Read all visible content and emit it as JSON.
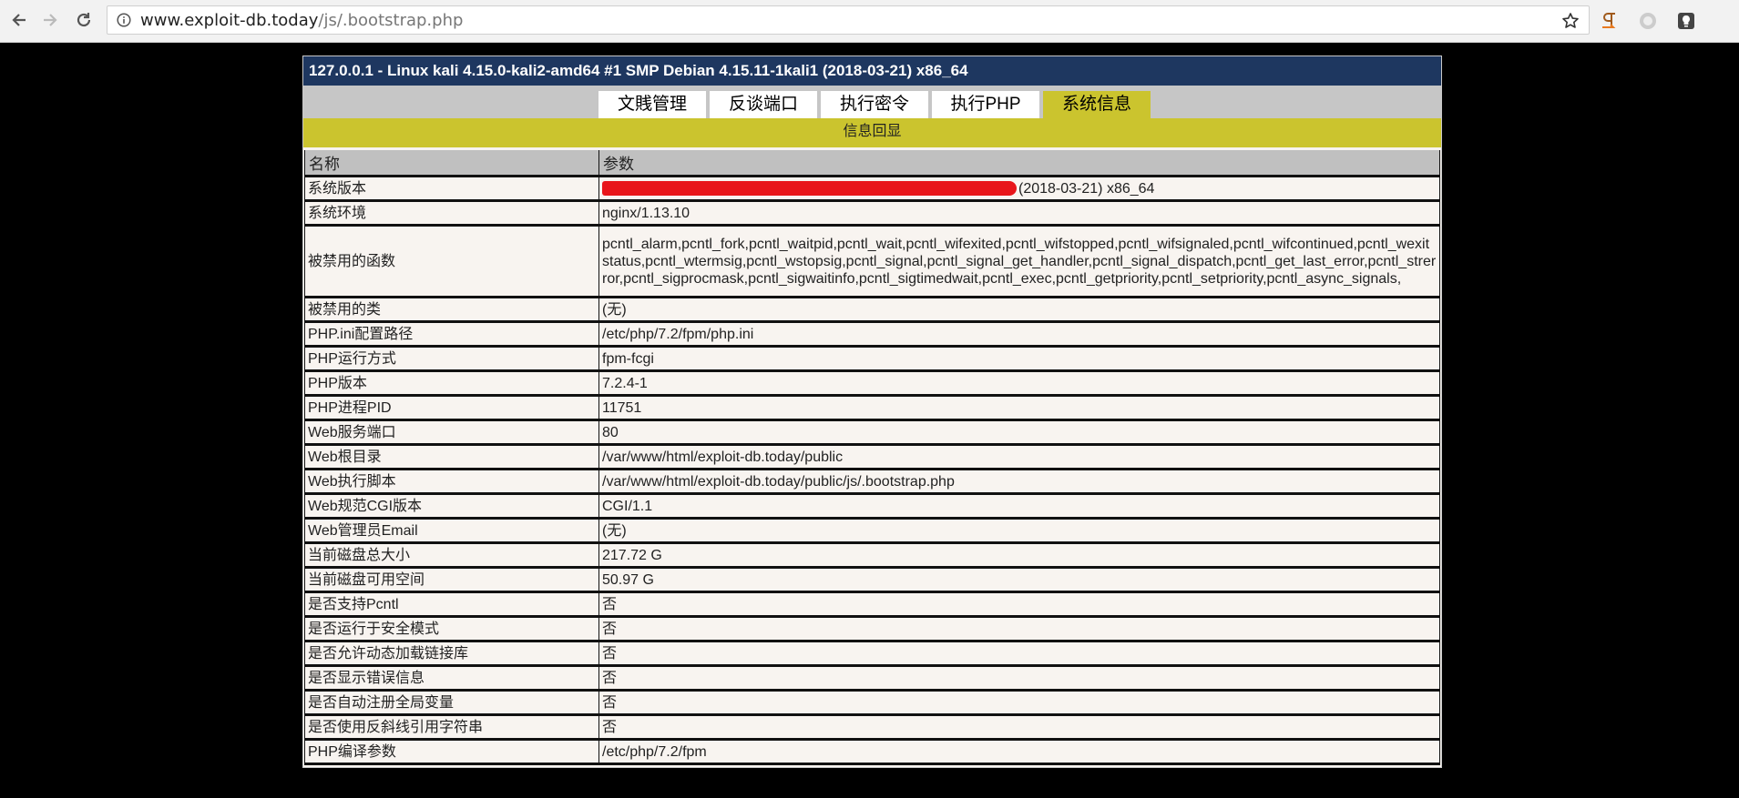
{
  "browser": {
    "url_host": "www.exploit-db.today",
    "url_path": "/js/.bootstrap.php"
  },
  "page": {
    "title": "127.0.0.1 - Linux kali 4.15.0-kali2-amd64 #1 SMP Debian 4.15.11-1kali1 (2018-03-21) x86_64",
    "tabs": [
      {
        "label": "文賎管理",
        "active": false
      },
      {
        "label": "反谈端口",
        "active": false
      },
      {
        "label": "执行密令",
        "active": false
      },
      {
        "label": "执行PHP",
        "active": false
      },
      {
        "label": "系统信息",
        "active": true
      }
    ],
    "section_title": "信息回显",
    "table": {
      "headers": [
        "名称",
        "参数"
      ],
      "rows": [
        {
          "name": "系统版本",
          "value": "(2018-03-21) x86_64"
        },
        {
          "name": "系统环境",
          "value": "nginx/1.13.10"
        },
        {
          "name": "被禁用的函数",
          "value": "pcntl_alarm,pcntl_fork,pcntl_waitpid,pcntl_wait,pcntl_wifexited,pcntl_wifstopped,pcntl_wifsignaled,pcntl_wifcontinued,pcntl_wexitstatus,pcntl_wtermsig,pcntl_wstopsig,pcntl_signal,pcntl_signal_get_handler,pcntl_signal_dispatch,pcntl_get_last_error,pcntl_strerror,pcntl_sigprocmask,pcntl_sigwaitinfo,pcntl_sigtimedwait,pcntl_exec,pcntl_getpriority,pcntl_setpriority,pcntl_async_signals,"
        },
        {
          "name": "被禁用的类",
          "value": "(无)"
        },
        {
          "name": "PHP.ini配置路径",
          "value": "/etc/php/7.2/fpm/php.ini"
        },
        {
          "name": "PHP运行方式",
          "value": "fpm-fcgi"
        },
        {
          "name": "PHP版本",
          "value": "7.2.4-1"
        },
        {
          "name": "PHP进程PID",
          "value": "11751"
        },
        {
          "name": "Web服务端口",
          "value": "80"
        },
        {
          "name": "Web根目录",
          "value": "/var/www/html/exploit-db.today/public"
        },
        {
          "name": "Web执行脚本",
          "value": "/var/www/html/exploit-db.today/public/js/.bootstrap.php"
        },
        {
          "name": "Web规范CGI版本",
          "value": "CGI/1.1"
        },
        {
          "name": "Web管理员Email",
          "value": "(无)"
        },
        {
          "name": "当前磁盘总大小",
          "value": "217.72 G"
        },
        {
          "name": "当前磁盘可用空间",
          "value": "50.97 G"
        },
        {
          "name": "是否支持Pcntl",
          "value": "否"
        },
        {
          "name": "是否运行于安全模式",
          "value": "否"
        },
        {
          "name": "是否允许动态加载链接库",
          "value": "否"
        },
        {
          "name": "是否显示错误信息",
          "value": "否"
        },
        {
          "name": "是否自动注册全局变量",
          "value": "否"
        },
        {
          "name": "是否使用反斜线引用字符串",
          "value": "否"
        },
        {
          "name": "PHP编译参数",
          "value": "/etc/php/7.2/fpm"
        }
      ]
    }
  },
  "icons": {
    "back": "back-arrow-icon",
    "forward": "forward-arrow-icon",
    "reload": "reload-icon",
    "info": "info-icon",
    "bookmark": "star-icon",
    "ext1": "paragraph-extension-icon",
    "ext2": "circle-extension-icon",
    "ext3": "bulb-extension-icon"
  },
  "colors": {
    "title_bar": "#1e3760",
    "active_tab": "#cbc42e",
    "redaction": "#e8161b"
  }
}
